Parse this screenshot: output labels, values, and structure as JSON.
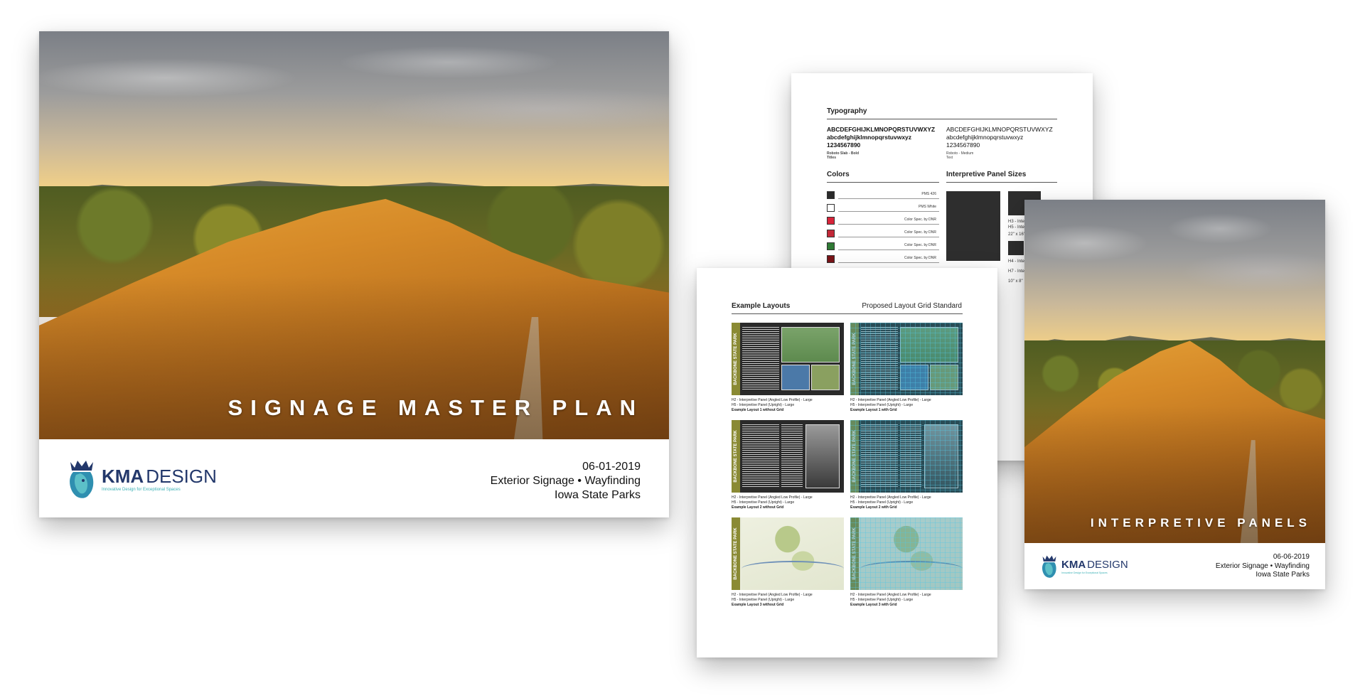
{
  "cover": {
    "title": "SIGNAGE MASTER PLAN",
    "date": "06-01-2019",
    "subtitle": "Exterior Signage • Wayfinding",
    "client": "Iowa State Parks"
  },
  "logo": {
    "name_bold": "KMA",
    "name_light": "DESIGN",
    "tagline": "Innovative Design for Exceptional Spaces"
  },
  "style_page": {
    "typography_heading": "Typography",
    "font_a": {
      "upper": "ABCDEFGHIJKLMNOPQRSTUVWXYZ",
      "lower": "abcdefghijklmnopqrstuvwxyz",
      "digits": "1234567890",
      "name": "Roboto Slab - Bold",
      "use": "Titles"
    },
    "font_b": {
      "upper": "ABCDEFGHIJKLMNOPQRSTUVWXYZ",
      "lower": "abcdefghijklmnopqrstuvwxyz",
      "digits": "1234567890",
      "name": "Roboto - Medium",
      "use": "Text"
    },
    "colors_heading": "Colors",
    "colors": [
      {
        "label": "PMS 426",
        "hex": "#2a2a2a"
      },
      {
        "label": "PMS White",
        "hex": "#ffffff"
      },
      {
        "label": "Color Spec. by DNR",
        "hex": "#d8243a"
      },
      {
        "label": "Color Spec. by DNR",
        "hex": "#c22838"
      },
      {
        "label": "Color Spec. by DNR",
        "hex": "#2f7a35"
      },
      {
        "label": "Color Spec. by DNR",
        "hex": "#7a1418"
      }
    ],
    "panel_sizes_heading": "Interpretive Panel Sizes",
    "panel_notes": [
      "H3 - Interp",
      "H5 - Interp",
      "22\" x 16\"",
      "H4 - Interp",
      "H7 - Interp",
      "10\" x 8\""
    ]
  },
  "layouts_page": {
    "heading_left": "Example Layouts",
    "heading_right": "Proposed Layout Grid Standard",
    "band_label": "BACKBONE STATE PARK",
    "items": [
      {
        "line1": "H2 - Interpretive Panel (Angled Low Profile) - Large",
        "line2": "H5 - Interpretive Panel (Upright) - Large",
        "caption": "Example Layout 1 without Grid"
      },
      {
        "line1": "H2 - Interpretive Panel (Angled Low Profile) - Large",
        "line2": "H5 - Interpretive Panel (Upright) - Large",
        "caption": "Example Layout 1 with Grid"
      },
      {
        "line1": "H2 - Interpretive Panel (Angled Low Profile) - Large",
        "line2": "H5 - Interpretive Panel (Upright) - Large",
        "caption": "Example Layout 2 without Grid"
      },
      {
        "line1": "H2 - Interpretive Panel (Angled Low Profile) - Large",
        "line2": "H5 - Interpretive Panel (Upright) - Large",
        "caption": "Example Layout 2 with Grid"
      },
      {
        "line1": "H2 - Interpretive Panel (Angled Low Profile) - Large",
        "line2": "H5 - Interpretive Panel (Upright) - Large",
        "caption": "Example Layout 3 without Grid"
      },
      {
        "line1": "H2 - Interpretive Panel (Angled Low Profile) - Large",
        "line2": "H5 - Interpretive Panel (Upright) - Large",
        "caption": "Example Layout 3 with Grid"
      }
    ]
  },
  "panels_cover": {
    "title": "INTERPRETIVE PANELS",
    "date": "06-06-2019",
    "subtitle": "Exterior Signage • Wayfinding",
    "client": "Iowa State Parks"
  }
}
